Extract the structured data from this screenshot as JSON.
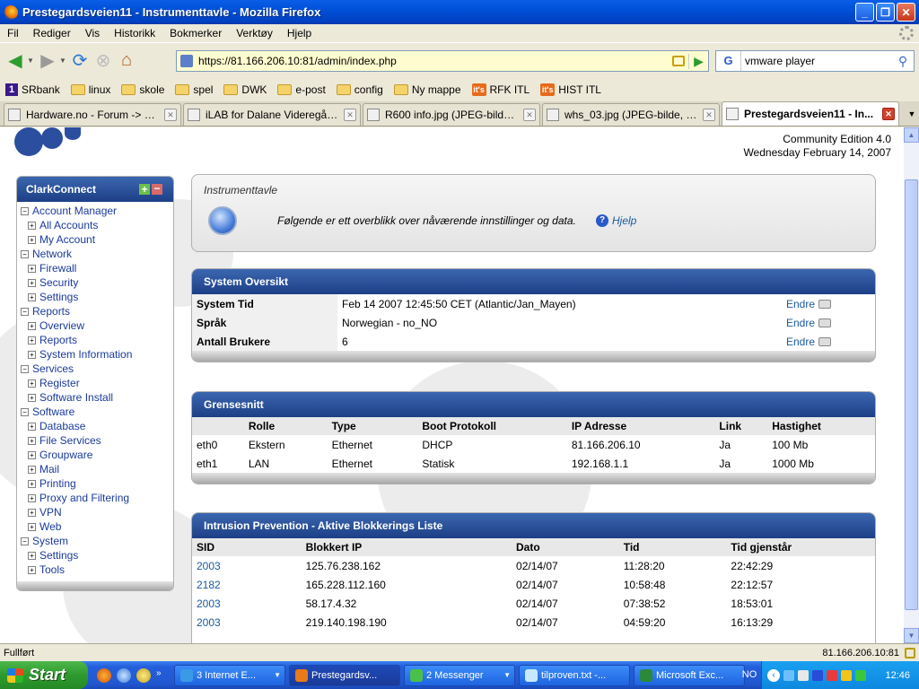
{
  "window": {
    "title": "Prestegardsveien11 - Instrumenttavle - Mozilla Firefox",
    "buttons": [
      "_",
      "❐",
      "✕"
    ]
  },
  "menu": [
    "Fil",
    "Rediger",
    "Vis",
    "Historikk",
    "Bokmerker",
    "Verktøy",
    "Hjelp"
  ],
  "nav": {
    "url": "https://81.166.206.10:81/admin/index.php",
    "search_value": "vmware player",
    "search_engine": "G"
  },
  "bookmarks": [
    {
      "label": "SRbank",
      "icon": "sparebank-icon"
    },
    {
      "label": "linux",
      "icon": "folder-icon"
    },
    {
      "label": "skole",
      "icon": "folder-icon"
    },
    {
      "label": "spel",
      "icon": "folder-icon"
    },
    {
      "label": "DWK",
      "icon": "folder-icon"
    },
    {
      "label": "e-post",
      "icon": "folder-icon"
    },
    {
      "label": "config",
      "icon": "folder-icon"
    },
    {
      "label": "Ny mappe",
      "icon": "folder-icon"
    },
    {
      "label": "RFK ITL",
      "icon": "its-icon"
    },
    {
      "label": "HIST ITL",
      "icon": "its-icon"
    }
  ],
  "tabs": [
    {
      "label": "Hardware.no - Forum -> Be...",
      "active": false
    },
    {
      "label": "iLAB for Dalane Videregåen...",
      "active": false
    },
    {
      "label": "R600 info.jpg (JPEG-bilde, ...",
      "active": false
    },
    {
      "label": "whs_03.jpg (JPEG-bilde, 10...",
      "active": false
    },
    {
      "label": "Prestegardsveien11 - In...",
      "active": true
    }
  ],
  "page": {
    "edition": "Community Edition 4.0",
    "date": "Wednesday February 14, 2007",
    "sidebar": {
      "title": "ClarkConnect",
      "items": [
        {
          "label": "Account Manager",
          "level": 0,
          "box": "−"
        },
        {
          "label": "All Accounts",
          "level": 1,
          "box": "+"
        },
        {
          "label": "My Account",
          "level": 1,
          "box": "+"
        },
        {
          "label": "Network",
          "level": 0,
          "box": "−"
        },
        {
          "label": "Firewall",
          "level": 1,
          "box": "+"
        },
        {
          "label": "Security",
          "level": 1,
          "box": "+"
        },
        {
          "label": "Settings",
          "level": 1,
          "box": "+"
        },
        {
          "label": "Reports",
          "level": 0,
          "box": "−"
        },
        {
          "label": "Overview",
          "level": 1,
          "box": "+"
        },
        {
          "label": "Reports",
          "level": 1,
          "box": "+"
        },
        {
          "label": "System Information",
          "level": 1,
          "box": "+"
        },
        {
          "label": "Services",
          "level": 0,
          "box": "−"
        },
        {
          "label": "Register",
          "level": 1,
          "box": "+"
        },
        {
          "label": "Software Install",
          "level": 1,
          "box": "+"
        },
        {
          "label": "Software",
          "level": 0,
          "box": "−"
        },
        {
          "label": "Database",
          "level": 1,
          "box": "+"
        },
        {
          "label": "File Services",
          "level": 1,
          "box": "+"
        },
        {
          "label": "Groupware",
          "level": 1,
          "box": "+"
        },
        {
          "label": "Mail",
          "level": 1,
          "box": "+"
        },
        {
          "label": "Printing",
          "level": 1,
          "box": "+"
        },
        {
          "label": "Proxy and Filtering",
          "level": 1,
          "box": "+"
        },
        {
          "label": "VPN",
          "level": 1,
          "box": "+"
        },
        {
          "label": "Web",
          "level": 1,
          "box": "+"
        },
        {
          "label": "System",
          "level": 0,
          "box": "−"
        },
        {
          "label": "Settings",
          "level": 1,
          "box": "+"
        },
        {
          "label": "Tools",
          "level": 1,
          "box": "+"
        }
      ]
    },
    "dashboard": {
      "title": "Instrumenttavle",
      "text": "Følgende er ett overblikk over nåværende innstillinger og data.",
      "help": "Hjelp"
    },
    "system_overview": {
      "title": "System Oversikt",
      "edit_label": "Endre",
      "rows": [
        {
          "label": "System Tid",
          "value": "Feb 14 2007 12:45:50 CET (Atlantic/Jan_Mayen)"
        },
        {
          "label": "Språk",
          "value": "Norwegian - no_NO"
        },
        {
          "label": "Antall Brukere",
          "value": "6"
        }
      ]
    },
    "interfaces": {
      "title": "Grensesnitt",
      "headers": [
        "",
        "Rolle",
        "Type",
        "Boot Protokoll",
        "IP Adresse",
        "Link",
        "Hastighet"
      ],
      "rows": [
        [
          "eth0",
          "Ekstern",
          "Ethernet",
          "DHCP",
          "81.166.206.10",
          "Ja",
          "100 Mb"
        ],
        [
          "eth1",
          "LAN",
          "Ethernet",
          "Statisk",
          "192.168.1.1",
          "Ja",
          "1000 Mb"
        ]
      ]
    },
    "intrusion": {
      "title": "Intrusion Prevention - Aktive Blokkerings Liste",
      "headers": [
        "SID",
        "Blokkert IP",
        "Dato",
        "Tid",
        "Tid gjenstår"
      ],
      "rows": [
        [
          "2003",
          "125.76.238.162",
          "02/14/07",
          "11:28:20",
          "22:42:29"
        ],
        [
          "2182",
          "165.228.112.160",
          "02/14/07",
          "10:58:48",
          "22:12:57"
        ],
        [
          "2003",
          "58.17.4.32",
          "02/14/07",
          "07:38:52",
          "18:53:01"
        ],
        [
          "2003",
          "219.140.198.190",
          "02/14/07",
          "04:59:20",
          "16:13:29"
        ]
      ]
    }
  },
  "status": {
    "text": "Fullført",
    "ip": "81.166.206.10:81"
  },
  "taskbar": {
    "start": "Start",
    "tasks": [
      {
        "label": "3 Internet E...",
        "active": false,
        "dropdown": true
      },
      {
        "label": "Prestegardsv...",
        "active": true,
        "dropdown": false
      },
      {
        "label": "2 Messenger",
        "active": false,
        "dropdown": true
      },
      {
        "label": "tilproven.txt -...",
        "active": false,
        "dropdown": false
      },
      {
        "label": "Microsoft Exc...",
        "active": false,
        "dropdown": false
      }
    ],
    "lang": "NO",
    "clock": "12:46"
  }
}
